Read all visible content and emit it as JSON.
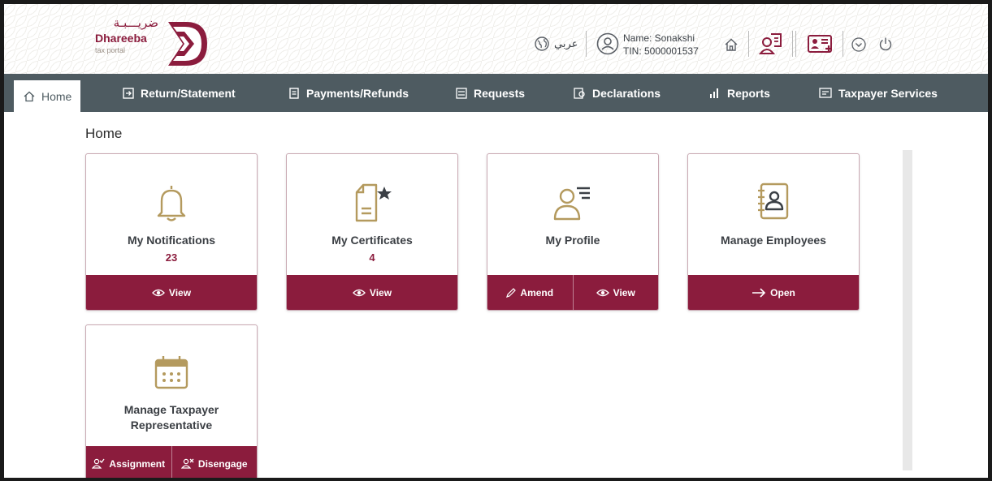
{
  "brand": {
    "arabic": "ضريـــبـة",
    "name": "Dhareeba",
    "subtitle": "tax portal"
  },
  "header": {
    "language_label": "عربي",
    "user_name": "Name: Sonakshi",
    "user_tin": "TIN: 5000001537",
    "icons": [
      "globe-icon",
      "user-circle-icon",
      "home-icon",
      "user-document-icon",
      "id-card-plus-icon",
      "chevron-circle-down-icon",
      "power-icon"
    ]
  },
  "nav": {
    "items": [
      {
        "label": "Home",
        "icon": "home-icon"
      },
      {
        "label": "Return/Statement",
        "icon": "return-icon"
      },
      {
        "label": "Payments/Refunds",
        "icon": "payments-icon"
      },
      {
        "label": "Requests",
        "icon": "requests-icon"
      },
      {
        "label": "Declarations",
        "icon": "declarations-icon"
      },
      {
        "label": "Reports",
        "icon": "reports-icon"
      },
      {
        "label": "Taxpayer Services",
        "icon": "taxpayer-services-icon"
      }
    ]
  },
  "page": {
    "title": "Home"
  },
  "cards": [
    {
      "title": "My Notifications",
      "count": "23",
      "icon": "bell-icon",
      "actions": [
        {
          "label": "View",
          "icon": "eye-icon"
        }
      ]
    },
    {
      "title": "My Certificates",
      "count": "4",
      "icon": "certificate-icon",
      "actions": [
        {
          "label": "View",
          "icon": "eye-icon"
        }
      ]
    },
    {
      "title": "My Profile",
      "icon": "profile-icon",
      "actions": [
        {
          "label": "Amend",
          "icon": "pencil-icon"
        },
        {
          "label": "View",
          "icon": "eye-icon"
        }
      ]
    },
    {
      "title": "Manage Employees",
      "icon": "contacts-book-icon",
      "actions": [
        {
          "label": "Open",
          "icon": "arrow-right-icon"
        }
      ]
    },
    {
      "title_line1": "Manage Taxpayer",
      "title_line2": "Representative",
      "icon": "calendar-icon",
      "actions": [
        {
          "label": "Assignment",
          "icon": "user-check-icon"
        },
        {
          "label": "Disengage",
          "icon": "user-x-icon"
        }
      ]
    }
  ],
  "colors": {
    "brand": "#8b1c3d",
    "nav_bg": "#4e5b61",
    "icon_gold": "#b49a5e"
  }
}
